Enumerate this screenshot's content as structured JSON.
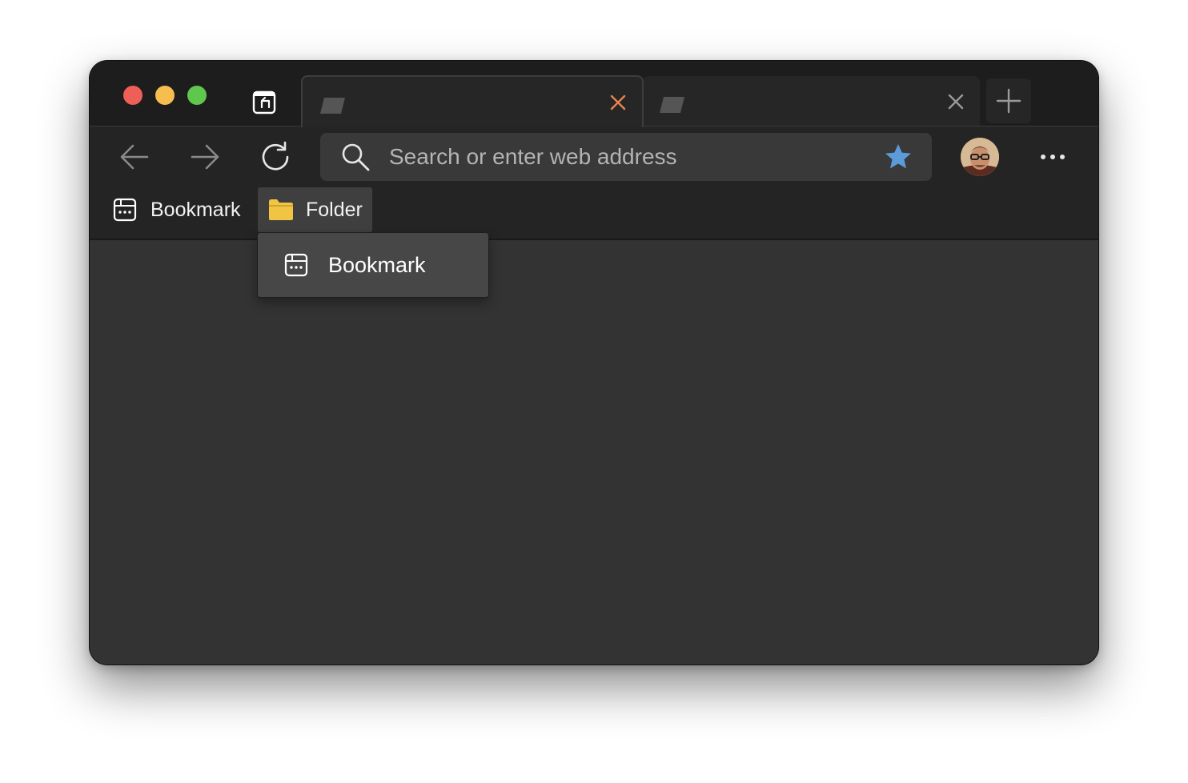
{
  "window": {
    "traffic_lights": {
      "close_color": "#ee5f57",
      "minimize_color": "#f6be4f",
      "maximize_color": "#5fc74e"
    },
    "tab_actions_icon": "tab-actions-icon"
  },
  "tabs": [
    {
      "favicon": "page-favicon",
      "close_icon": "close-icon",
      "close_color": "#e8834d",
      "active": true
    },
    {
      "favicon": "page-favicon",
      "close_icon": "close-icon",
      "close_color": "#9a9a9a",
      "active": false
    }
  ],
  "toolbar": {
    "back_icon": "arrow-left-icon",
    "forward_icon": "arrow-right-icon",
    "reload_icon": "reload-icon",
    "search_icon": "search-icon",
    "address_placeholder": "Search or enter web address",
    "address_value": "",
    "favorite_icon": "star-icon",
    "favorite_color": "#5b9bdb",
    "profile_icon": "avatar",
    "more_icon": "more-icon"
  },
  "bookmarks_bar": {
    "items": [
      {
        "label": "Bookmark",
        "icon": "bookmark-icon"
      },
      {
        "label": "Folder",
        "icon": "folder-icon",
        "folder_color": "#f0c544"
      }
    ]
  },
  "folder_menu": {
    "items": [
      {
        "label": "Bookmark",
        "icon": "bookmark-icon"
      }
    ]
  }
}
